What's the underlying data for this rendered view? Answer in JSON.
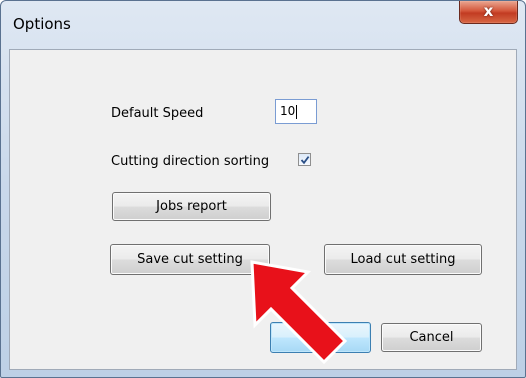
{
  "window": {
    "title": "Options",
    "close_glyph": "x"
  },
  "form": {
    "speed_label": "Default Speed",
    "speed_value": "10",
    "sorting_label": "Cutting direction sorting",
    "sorting_checked": true
  },
  "buttons": {
    "jobs_report": "Jobs report",
    "save_cut": "Save cut setting",
    "load_cut": "Load cut setting",
    "ok": "",
    "cancel": "Cancel"
  },
  "overlay": {
    "arrow_color": "#e8111a",
    "arrow_outline": "#ffffff"
  },
  "icons": {
    "close": "close-icon",
    "check": "checkmark-icon"
  }
}
